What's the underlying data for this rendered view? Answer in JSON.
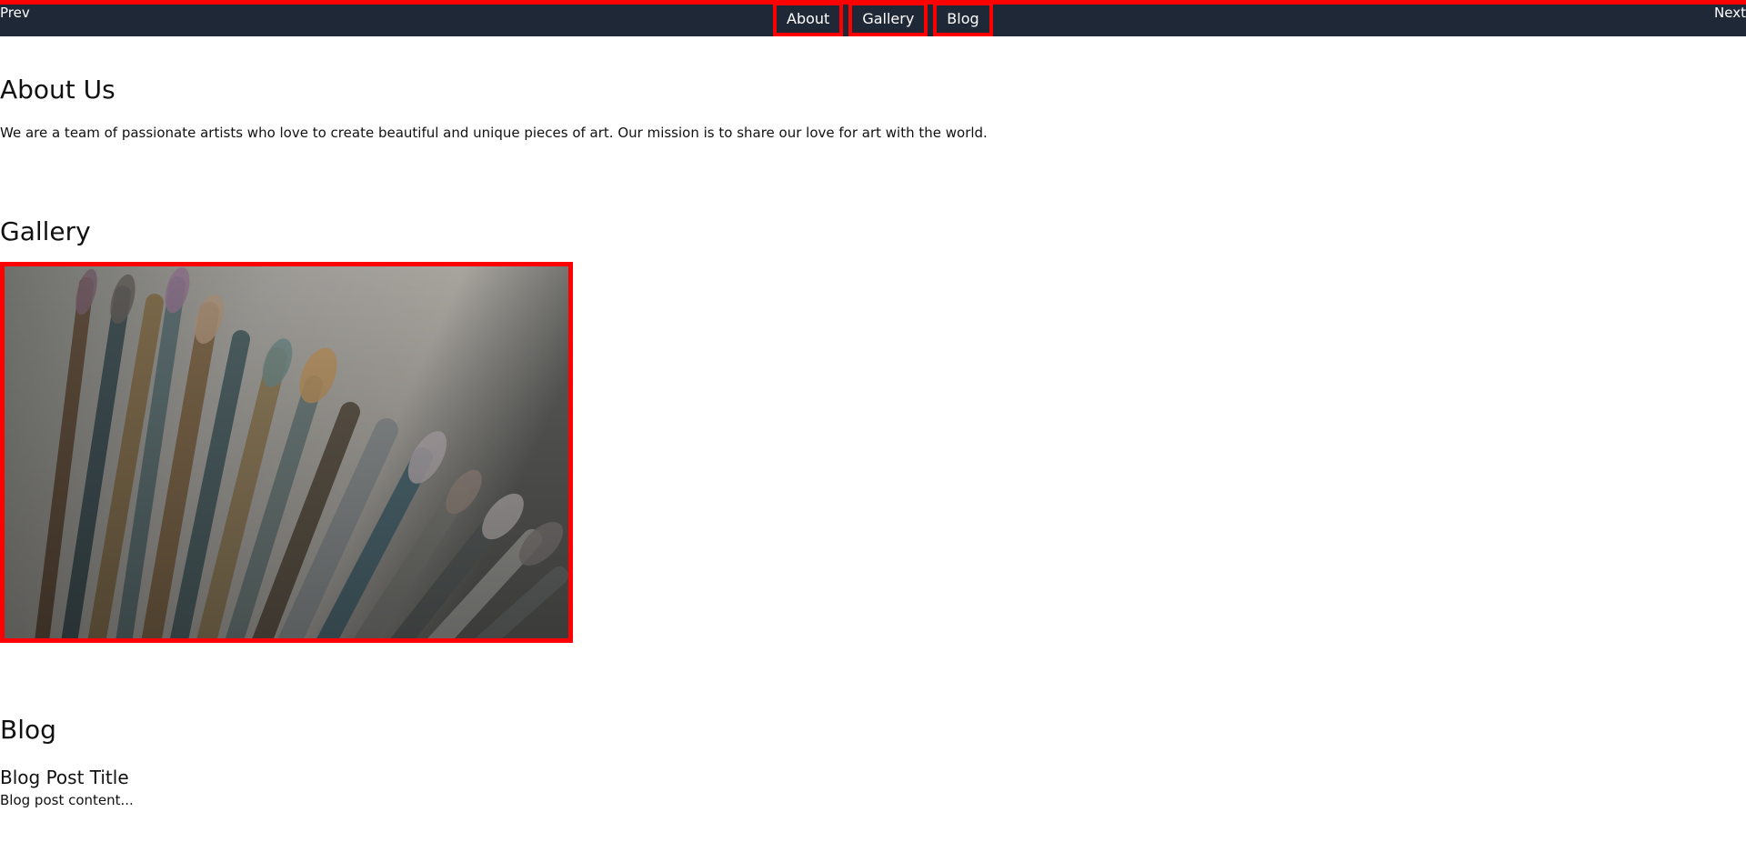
{
  "nav": {
    "prev_label": "Prev",
    "next_label": "Next",
    "links": [
      {
        "label": "About"
      },
      {
        "label": "Gallery"
      },
      {
        "label": "Blog"
      }
    ]
  },
  "about": {
    "title": "About Us",
    "text": "We are a team of passionate artists who love to create beautiful and unique pieces of art. Our mission is to share our love for art with the world."
  },
  "gallery": {
    "title": "Gallery",
    "image": "paint-brushes-photo"
  },
  "blog": {
    "title": "Blog",
    "post_title": "Blog Post Title",
    "post_content": "Blog post content..."
  },
  "colors": {
    "navbar_bg": "#1f2836",
    "highlight_border": "#ff0000",
    "text": "#111111",
    "nav_text": "#ffffff"
  }
}
